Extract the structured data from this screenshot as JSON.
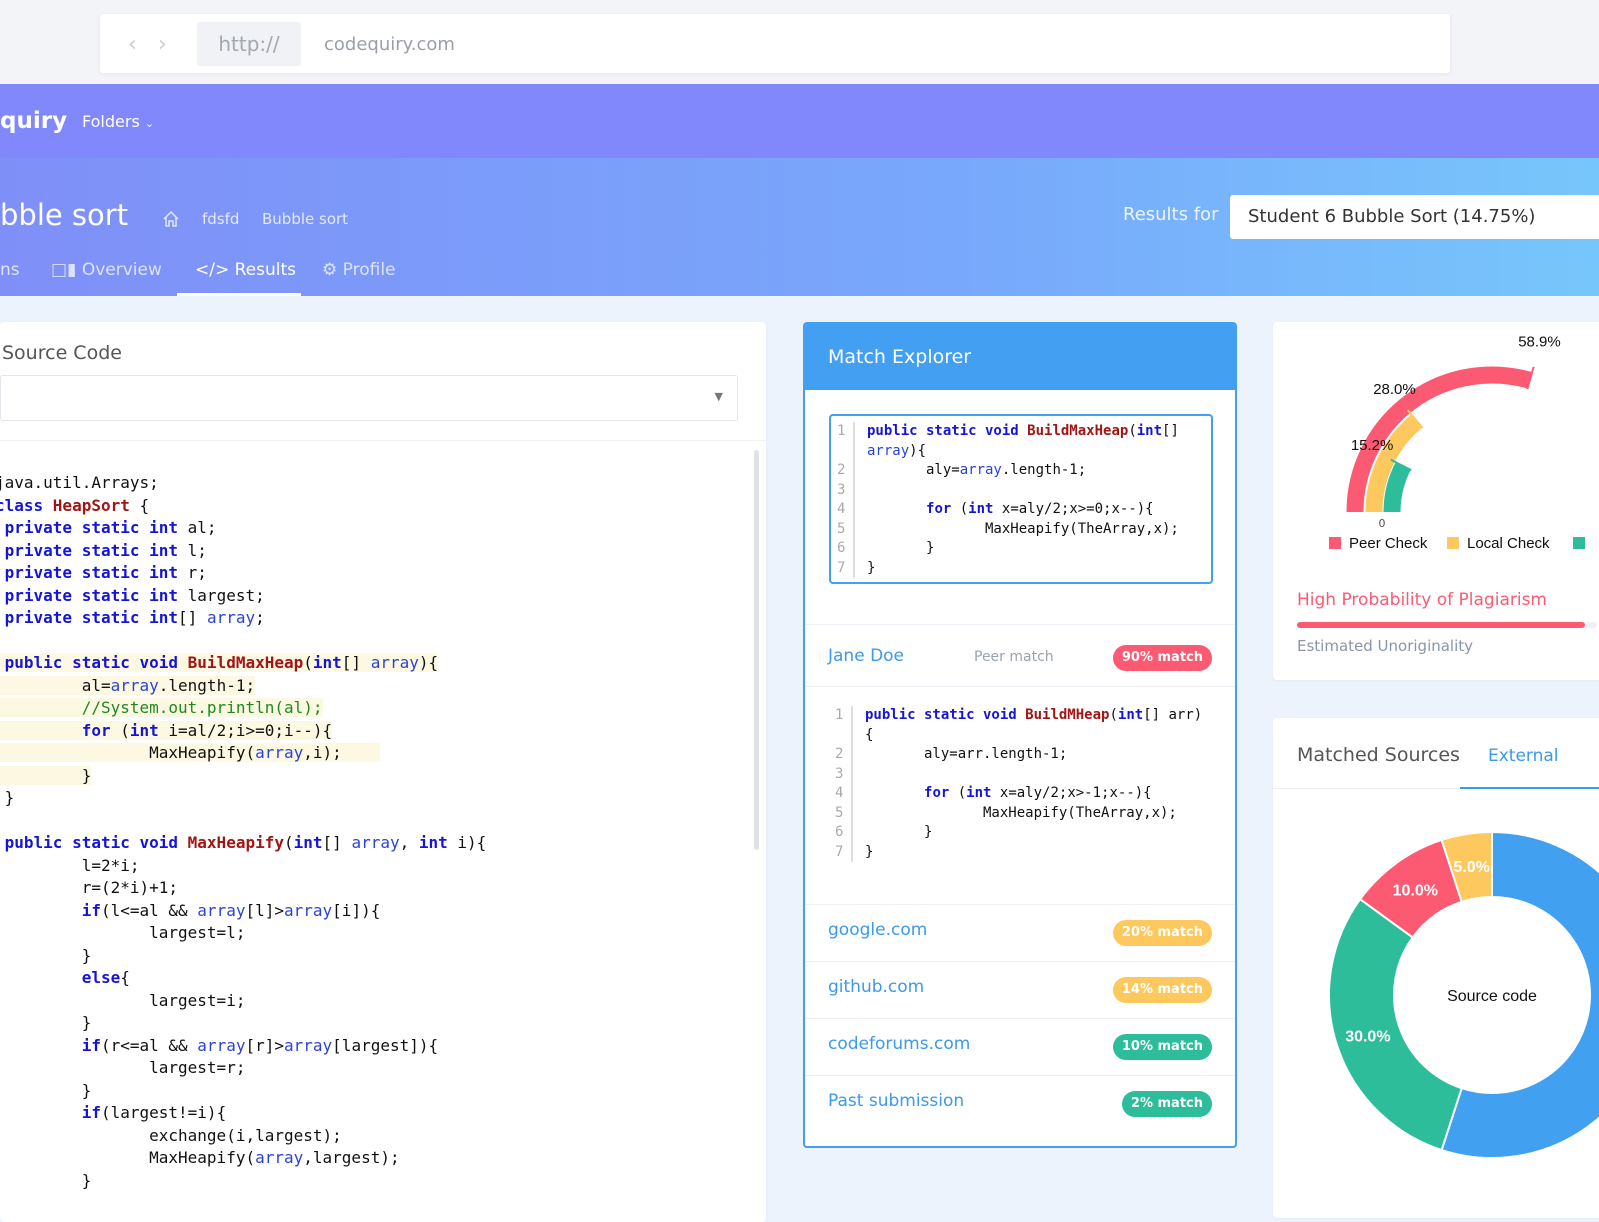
{
  "browser": {
    "protocol": "http://",
    "url": "codequiry.com"
  },
  "navbar": {
    "brand": "quiry",
    "folders": "Folders"
  },
  "header": {
    "title": "bble sort",
    "breadcrumb": [
      "fdsfd",
      "Bubble sort"
    ],
    "results_for": "Results for",
    "results_select": "Student 6 Bubble Sort (14.75%)"
  },
  "tabs": [
    {
      "label": "ns"
    },
    {
      "label": "Overview",
      "icon": "bar-chart-icon"
    },
    {
      "label": "Results",
      "icon": "code-icon",
      "active": true
    },
    {
      "label": "Profile",
      "icon": "gears-icon"
    }
  ],
  "source": {
    "title": "Source Code",
    "select_value": "",
    "lines": [
      {
        "t": [
          [
            "java.util.Arrays;",
            ""
          ]
        ]
      },
      {
        "t": [
          [
            "class ",
            "kw"
          ],
          [
            "HeapSort",
            "fn"
          ],
          [
            " {",
            ""
          ]
        ]
      },
      {
        "t": [
          [
            " private static int",
            "kw"
          ],
          [
            " al;",
            ""
          ]
        ]
      },
      {
        "t": [
          [
            " private static int",
            "kw"
          ],
          [
            " l;",
            ""
          ]
        ]
      },
      {
        "t": [
          [
            " private static int",
            "kw"
          ],
          [
            " r;",
            ""
          ]
        ]
      },
      {
        "t": [
          [
            " private static int",
            "kw"
          ],
          [
            " largest;",
            ""
          ]
        ]
      },
      {
        "t": [
          [
            " private static int",
            "kw"
          ],
          [
            "[] ",
            ""
          ],
          [
            "array",
            "vr"
          ],
          [
            ";",
            ""
          ]
        ]
      },
      {
        "t": []
      },
      {
        "hl": true,
        "t": [
          [
            " public static void ",
            "kw"
          ],
          [
            "BuildMaxHeap",
            "fn"
          ],
          [
            "(",
            ""
          ],
          [
            "int",
            "kw"
          ],
          [
            "[] ",
            ""
          ],
          [
            "array",
            "vr"
          ],
          [
            "){",
            ""
          ]
        ]
      },
      {
        "hl": true,
        "t": [
          [
            "         al=",
            ""
          ],
          [
            "array",
            "vr"
          ],
          [
            ".length-1;",
            ""
          ]
        ]
      },
      {
        "hl": true,
        "t": [
          [
            "         //System.out.println(al);",
            "cm"
          ]
        ]
      },
      {
        "hl": true,
        "t": [
          [
            "         ",
            ""
          ],
          [
            "for",
            "kw"
          ],
          [
            " (",
            ""
          ],
          [
            "int",
            "kw"
          ],
          [
            " i=al/2;i>=0;i--){",
            ""
          ]
        ]
      },
      {
        "hl": true,
        "t": [
          [
            "                MaxHeapify(",
            ""
          ],
          [
            "array",
            "vr"
          ],
          [
            ",i);    ",
            ""
          ]
        ]
      },
      {
        "hl": true,
        "t": [
          [
            "         }",
            ""
          ]
        ]
      },
      {
        "t": [
          [
            " }",
            ""
          ]
        ]
      },
      {
        "t": []
      },
      {
        "t": [
          [
            " public static void ",
            "kw"
          ],
          [
            "MaxHeapify",
            "fn"
          ],
          [
            "(",
            ""
          ],
          [
            "int",
            "kw"
          ],
          [
            "[] ",
            ""
          ],
          [
            "array",
            "vr"
          ],
          [
            ", ",
            ""
          ],
          [
            "int",
            "kw"
          ],
          [
            " i){",
            ""
          ]
        ]
      },
      {
        "t": [
          [
            "         l=2*i;",
            ""
          ]
        ]
      },
      {
        "t": [
          [
            "         r=(2*i)+1;",
            ""
          ]
        ]
      },
      {
        "t": [
          [
            "         ",
            ""
          ],
          [
            "if",
            "kw"
          ],
          [
            "(l<=al && ",
            ""
          ],
          [
            "array",
            "vr"
          ],
          [
            "[l]>",
            ""
          ],
          [
            "array",
            "vr"
          ],
          [
            "[i]){",
            ""
          ]
        ]
      },
      {
        "t": [
          [
            "                largest=l;",
            ""
          ]
        ]
      },
      {
        "t": [
          [
            "         }",
            ""
          ]
        ]
      },
      {
        "t": [
          [
            "         ",
            ""
          ],
          [
            "else",
            "kw"
          ],
          [
            "{",
            ""
          ]
        ]
      },
      {
        "t": [
          [
            "                largest=i;",
            ""
          ]
        ]
      },
      {
        "t": [
          [
            "         }",
            ""
          ]
        ]
      },
      {
        "t": [
          [
            "         ",
            ""
          ],
          [
            "if",
            "kw"
          ],
          [
            "(r<=al && ",
            ""
          ],
          [
            "array",
            "vr"
          ],
          [
            "[r]>",
            ""
          ],
          [
            "array",
            "vr"
          ],
          [
            "[largest]){",
            ""
          ]
        ]
      },
      {
        "t": [
          [
            "                largest=r;",
            ""
          ]
        ]
      },
      {
        "t": [
          [
            "         }",
            ""
          ]
        ]
      },
      {
        "t": [
          [
            "         ",
            ""
          ],
          [
            "if",
            "kw"
          ],
          [
            "(largest!=i){",
            ""
          ]
        ]
      },
      {
        "t": [
          [
            "                exchange(i,largest);",
            ""
          ]
        ]
      },
      {
        "t": [
          [
            "                MaxHeapify(",
            ""
          ],
          [
            "array",
            "vr"
          ],
          [
            ",largest);",
            ""
          ]
        ]
      },
      {
        "t": [
          [
            "         }",
            ""
          ]
        ]
      }
    ]
  },
  "match_explorer": {
    "title": "Match Explorer",
    "snippet_a": [
      {
        "n": "1",
        "t": [
          [
            "public static void ",
            "kw"
          ],
          [
            "BuildMaxHeap",
            "fn"
          ],
          [
            "(",
            ""
          ],
          [
            "int",
            "kw"
          ],
          [
            "[]",
            ""
          ]
        ]
      },
      {
        "n": "",
        "t": [
          [
            "array",
            "vr"
          ],
          [
            "){",
            ""
          ]
        ]
      },
      {
        "n": "2",
        "t": [
          [
            "       aly=",
            ""
          ],
          [
            "array",
            "vr"
          ],
          [
            ".length-1;",
            ""
          ]
        ]
      },
      {
        "n": "3",
        "t": []
      },
      {
        "n": "4",
        "t": [
          [
            "       ",
            ""
          ],
          [
            "for",
            "kw"
          ],
          [
            " (",
            ""
          ],
          [
            "int",
            "kw"
          ],
          [
            " x=aly/2;x>=0;x--){",
            ""
          ]
        ]
      },
      {
        "n": "5",
        "t": [
          [
            "              MaxHeapify(TheArray,x);",
            ""
          ]
        ]
      },
      {
        "n": "6",
        "t": [
          [
            "       }",
            ""
          ]
        ]
      },
      {
        "n": "7",
        "t": [
          [
            "}",
            ""
          ]
        ]
      }
    ],
    "peer": {
      "name": "Jane Doe",
      "type": "Peer match",
      "badge": "90% match",
      "color": "#fc5a72"
    },
    "snippet_b": [
      {
        "n": "1",
        "t": [
          [
            "public static void ",
            "kw"
          ],
          [
            "BuildMHeap",
            "fn"
          ],
          [
            "(",
            ""
          ],
          [
            "int",
            "kw"
          ],
          [
            "[] arr)",
            ""
          ]
        ]
      },
      {
        "n": "",
        "t": [
          [
            "{",
            ""
          ]
        ]
      },
      {
        "n": "2",
        "t": [
          [
            "       aly=arr.length-1;",
            ""
          ]
        ]
      },
      {
        "n": "3",
        "t": []
      },
      {
        "n": "4",
        "t": [
          [
            "       ",
            ""
          ],
          [
            "for",
            "kw"
          ],
          [
            " (",
            ""
          ],
          [
            "int",
            "kw"
          ],
          [
            " x=aly/2;x>-1;x--){",
            ""
          ]
        ]
      },
      {
        "n": "5",
        "t": [
          [
            "              MaxHeapify(TheArray,x);",
            ""
          ]
        ]
      },
      {
        "n": "6",
        "t": [
          [
            "       }",
            ""
          ]
        ]
      },
      {
        "n": "7",
        "t": [
          [
            "}",
            ""
          ]
        ]
      }
    ],
    "sources": [
      {
        "name": "google.com",
        "badge": "20% match",
        "color": "#fdc95f"
      },
      {
        "name": "github.com",
        "badge": "14% match",
        "color": "#fdc95f"
      },
      {
        "name": "codeforums.com",
        "badge": "10% match",
        "color": "#2dbd9b"
      },
      {
        "name": "Past submission",
        "badge": "2% match",
        "color": "#2dbd9b"
      }
    ]
  },
  "chart_data": [
    {
      "type": "radial-bar",
      "max": 100,
      "axis_label": "0",
      "series": [
        {
          "name": "Peer Check",
          "value": 58.9,
          "label": "58.9%",
          "color": "#fc5a72"
        },
        {
          "name": "Local Check",
          "value": 28.0,
          "label": "28.0%",
          "color": "#fdc95f"
        },
        {
          "value": 15.2,
          "label": "15.2%",
          "color": "#2dbd9b"
        }
      ],
      "legend": "bottom"
    },
    {
      "type": "pie",
      "donut": true,
      "center_label": "Source code",
      "slices": [
        {
          "value": 55,
          "color": "#42a0f1",
          "label": ""
        },
        {
          "value": 30,
          "label": "30.0%",
          "color": "#2dbd9b"
        },
        {
          "value": 10,
          "label": "10.0%",
          "color": "#fc5a72"
        },
        {
          "value": 5,
          "label": "5.0%",
          "color": "#fdc95f"
        }
      ]
    }
  ],
  "verdict": {
    "label": "High Probability of Plagiarism",
    "sub": "Estimated Unoriginality",
    "color": "#fc5a72",
    "progress": 0.96
  },
  "matched_sources": {
    "title": "Matched Sources",
    "tab": "External"
  }
}
